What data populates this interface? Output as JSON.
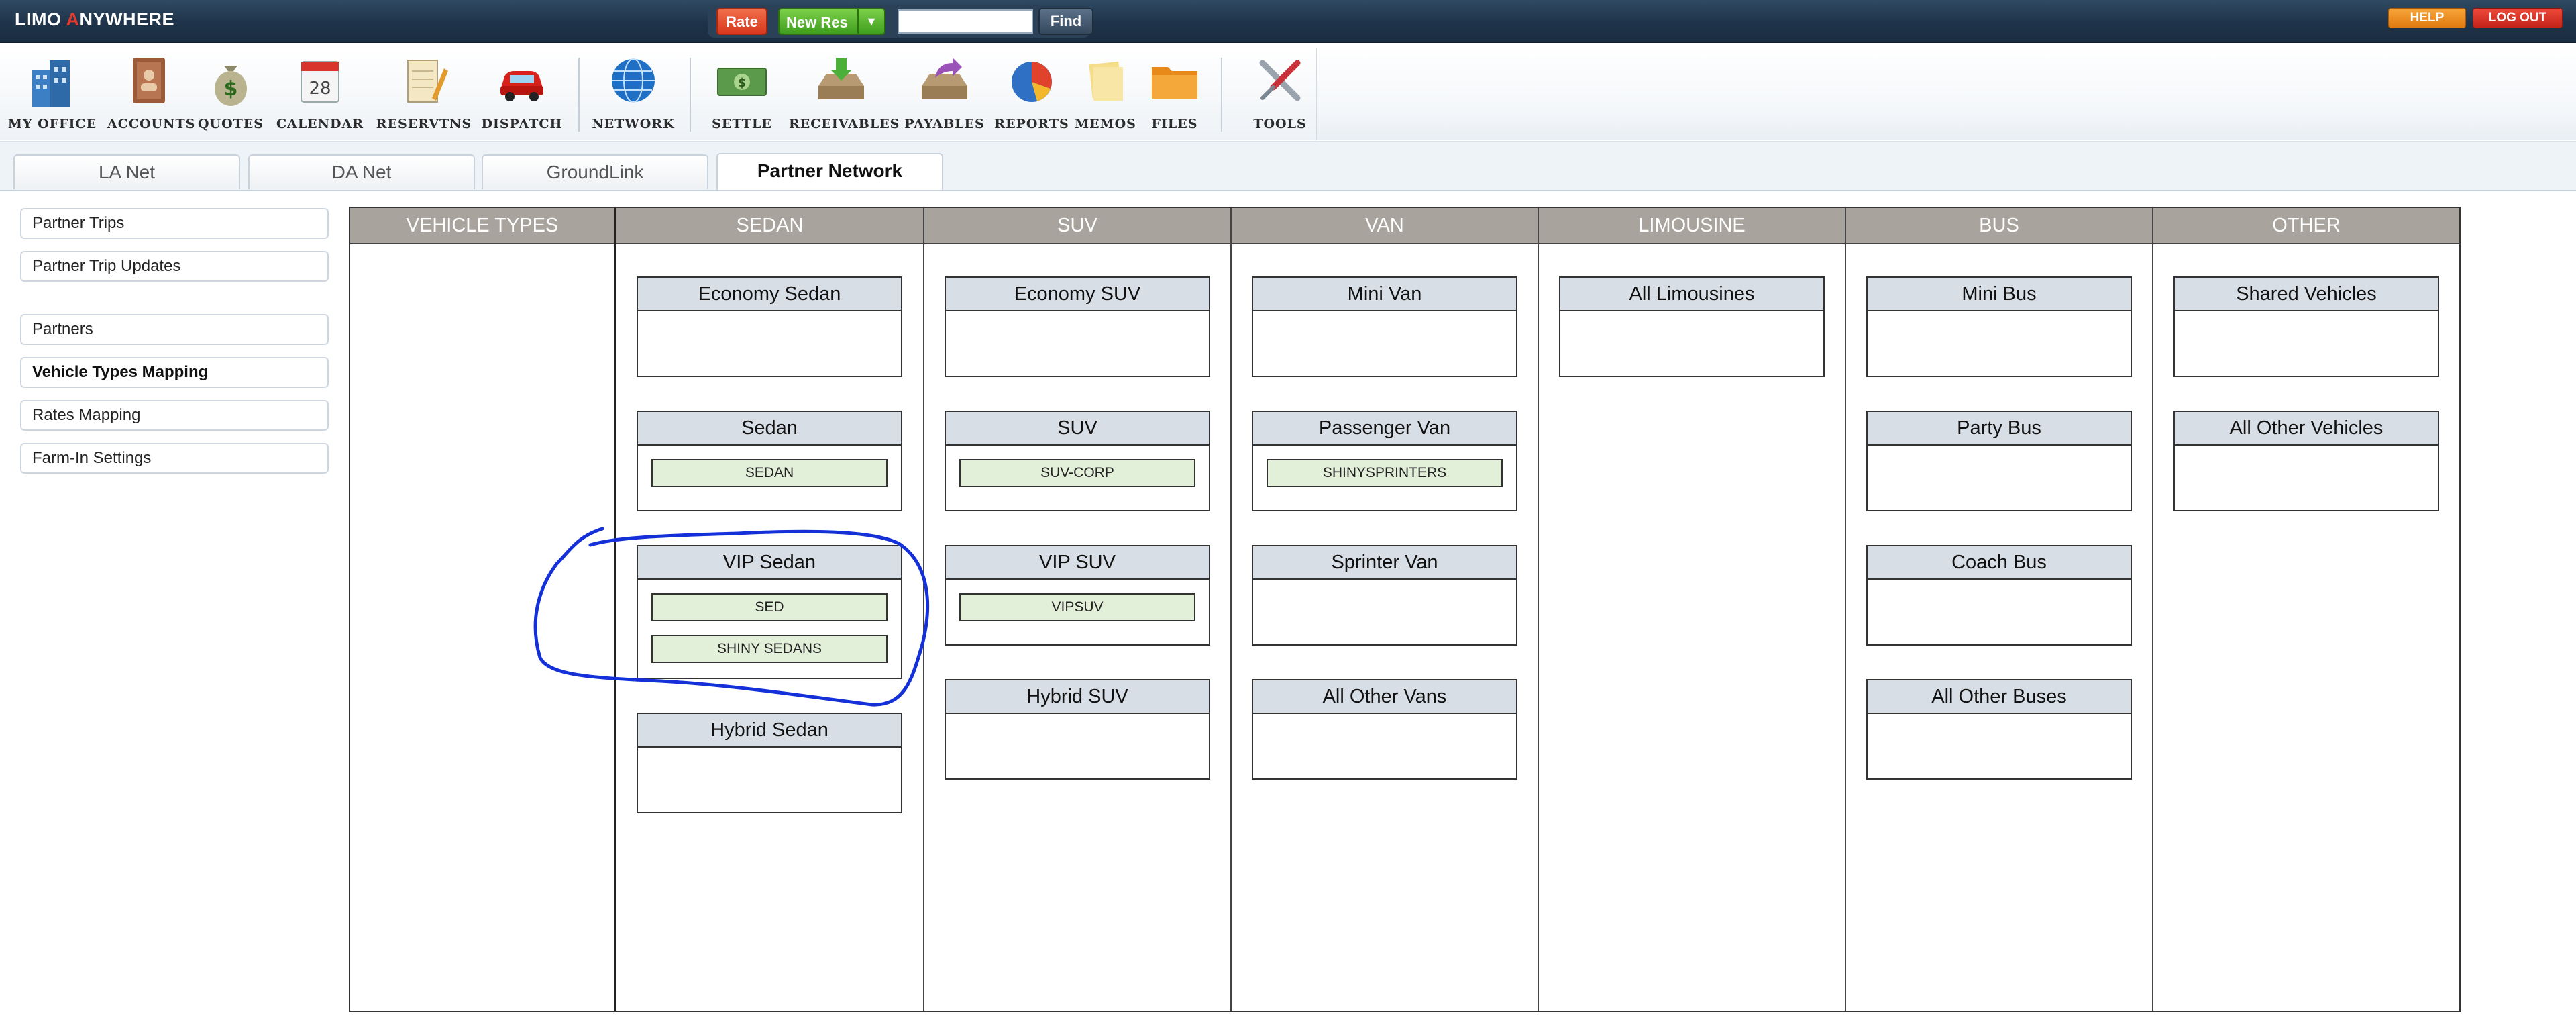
{
  "app": {
    "logo_left": "LIMO ",
    "logo_accent": "A",
    "logo_right": "NYWHERE"
  },
  "header": {
    "rate_label": "Rate",
    "new_res_label": "New Res",
    "search_value": "",
    "find_label": "Find",
    "help_label": "HELP",
    "logout_label": "LOG OUT"
  },
  "toolbar": [
    {
      "label": "MY OFFICE",
      "icon": "office-building-icon"
    },
    {
      "label": "ACCOUNTS",
      "icon": "address-book-icon"
    },
    {
      "label": "QUOTES",
      "icon": "money-bag-icon"
    },
    {
      "label": "CALENDAR",
      "icon": "calendar-icon",
      "day": "28"
    },
    {
      "label": "RESERVTNS",
      "icon": "notepad-pencil-icon"
    },
    {
      "label": "DISPATCH",
      "icon": "red-car-icon"
    },
    {
      "label": "NETWORK",
      "icon": "globe-icon"
    },
    {
      "label": "SETTLE",
      "icon": "dollar-bill-icon"
    },
    {
      "label": "RECEIVABLES",
      "icon": "inbox-tray-icon"
    },
    {
      "label": "PAYABLES",
      "icon": "outbox-tray-icon"
    },
    {
      "label": "REPORTS",
      "icon": "pie-chart-icon"
    },
    {
      "label": "MEMOS",
      "icon": "sticky-note-icon"
    },
    {
      "label": "FILES",
      "icon": "folder-icon"
    },
    {
      "label": "TOOLS",
      "icon": "wrench-screwdriver-icon"
    }
  ],
  "tabs": [
    {
      "label": "LA Net",
      "active": false
    },
    {
      "label": "DA Net",
      "active": false
    },
    {
      "label": "GroundLink",
      "active": false
    },
    {
      "label": "Partner Network",
      "active": true
    }
  ],
  "sidebar": {
    "items": [
      {
        "label": "Partner Trips"
      },
      {
        "label": "Partner Trip Updates"
      },
      {
        "label": "Partners"
      },
      {
        "label": "Vehicle Types Mapping",
        "active": true
      },
      {
        "label": "Rates Mapping"
      },
      {
        "label": "Farm-In Settings"
      }
    ]
  },
  "grid": {
    "columns": [
      {
        "header": "VEHICLE TYPES",
        "types": []
      },
      {
        "header": "SEDAN",
        "types": [
          {
            "name": "Economy Sedan",
            "tags": []
          },
          {
            "name": "Sedan",
            "tags": [
              "SEDAN"
            ]
          },
          {
            "name": "VIP Sedan",
            "tags": [
              "SED",
              "SHINY SEDANS"
            ]
          },
          {
            "name": "Hybrid Sedan",
            "tags": []
          }
        ]
      },
      {
        "header": "SUV",
        "types": [
          {
            "name": "Economy SUV",
            "tags": []
          },
          {
            "name": "SUV",
            "tags": [
              "SUV-CORP"
            ]
          },
          {
            "name": "VIP SUV",
            "tags": [
              "VIPSUV"
            ]
          },
          {
            "name": "Hybrid SUV",
            "tags": []
          }
        ]
      },
      {
        "header": "VAN",
        "types": [
          {
            "name": "Mini Van",
            "tags": []
          },
          {
            "name": "Passenger Van",
            "tags": [
              "SHINYSPRINTERS"
            ]
          },
          {
            "name": "Sprinter Van",
            "tags": []
          },
          {
            "name": "All Other Vans",
            "tags": []
          }
        ]
      },
      {
        "header": "LIMOUSINE",
        "types": [
          {
            "name": "All Limousines",
            "tags": []
          }
        ]
      },
      {
        "header": "BUS",
        "types": [
          {
            "name": "Mini Bus",
            "tags": []
          },
          {
            "name": "Party Bus",
            "tags": []
          },
          {
            "name": "Coach Bus",
            "tags": []
          },
          {
            "name": "All Other Buses",
            "tags": []
          }
        ]
      },
      {
        "header": "OTHER",
        "types": [
          {
            "name": "Shared Vehicles",
            "tags": []
          },
          {
            "name": "All Other Vehicles",
            "tags": []
          }
        ]
      }
    ]
  },
  "colors": {
    "header_bar": "#1f344a",
    "column_header": "#a8a39c",
    "type_header": "#d8dee6",
    "tag_fill": "#e2efd9",
    "annotation": "#1430d8"
  }
}
